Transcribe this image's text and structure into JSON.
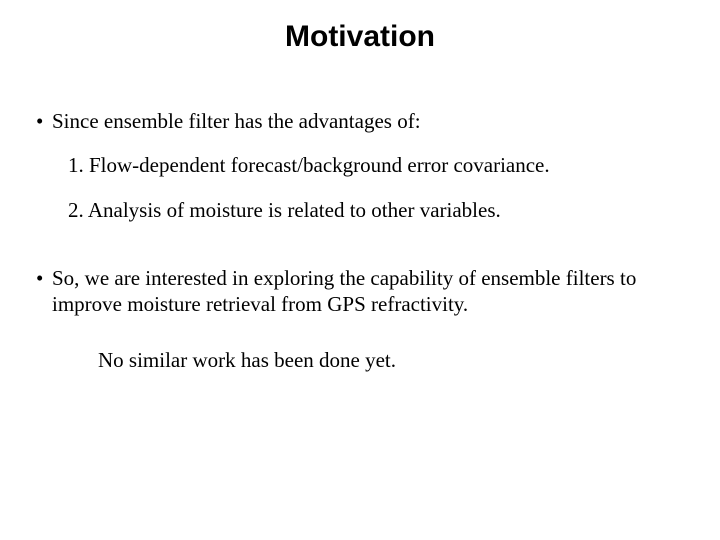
{
  "title": "Motivation",
  "bullet1": "Since ensemble filter has the advantages of:",
  "sub1": "1.  Flow-dependent forecast/background error covariance.",
  "sub2": "2.  Analysis of moisture is related to other variables.",
  "bullet2": "So, we are interested in exploring the capability of ensemble filters to improve moisture retrieval from GPS refractivity.",
  "note": "No similar work has been done yet."
}
